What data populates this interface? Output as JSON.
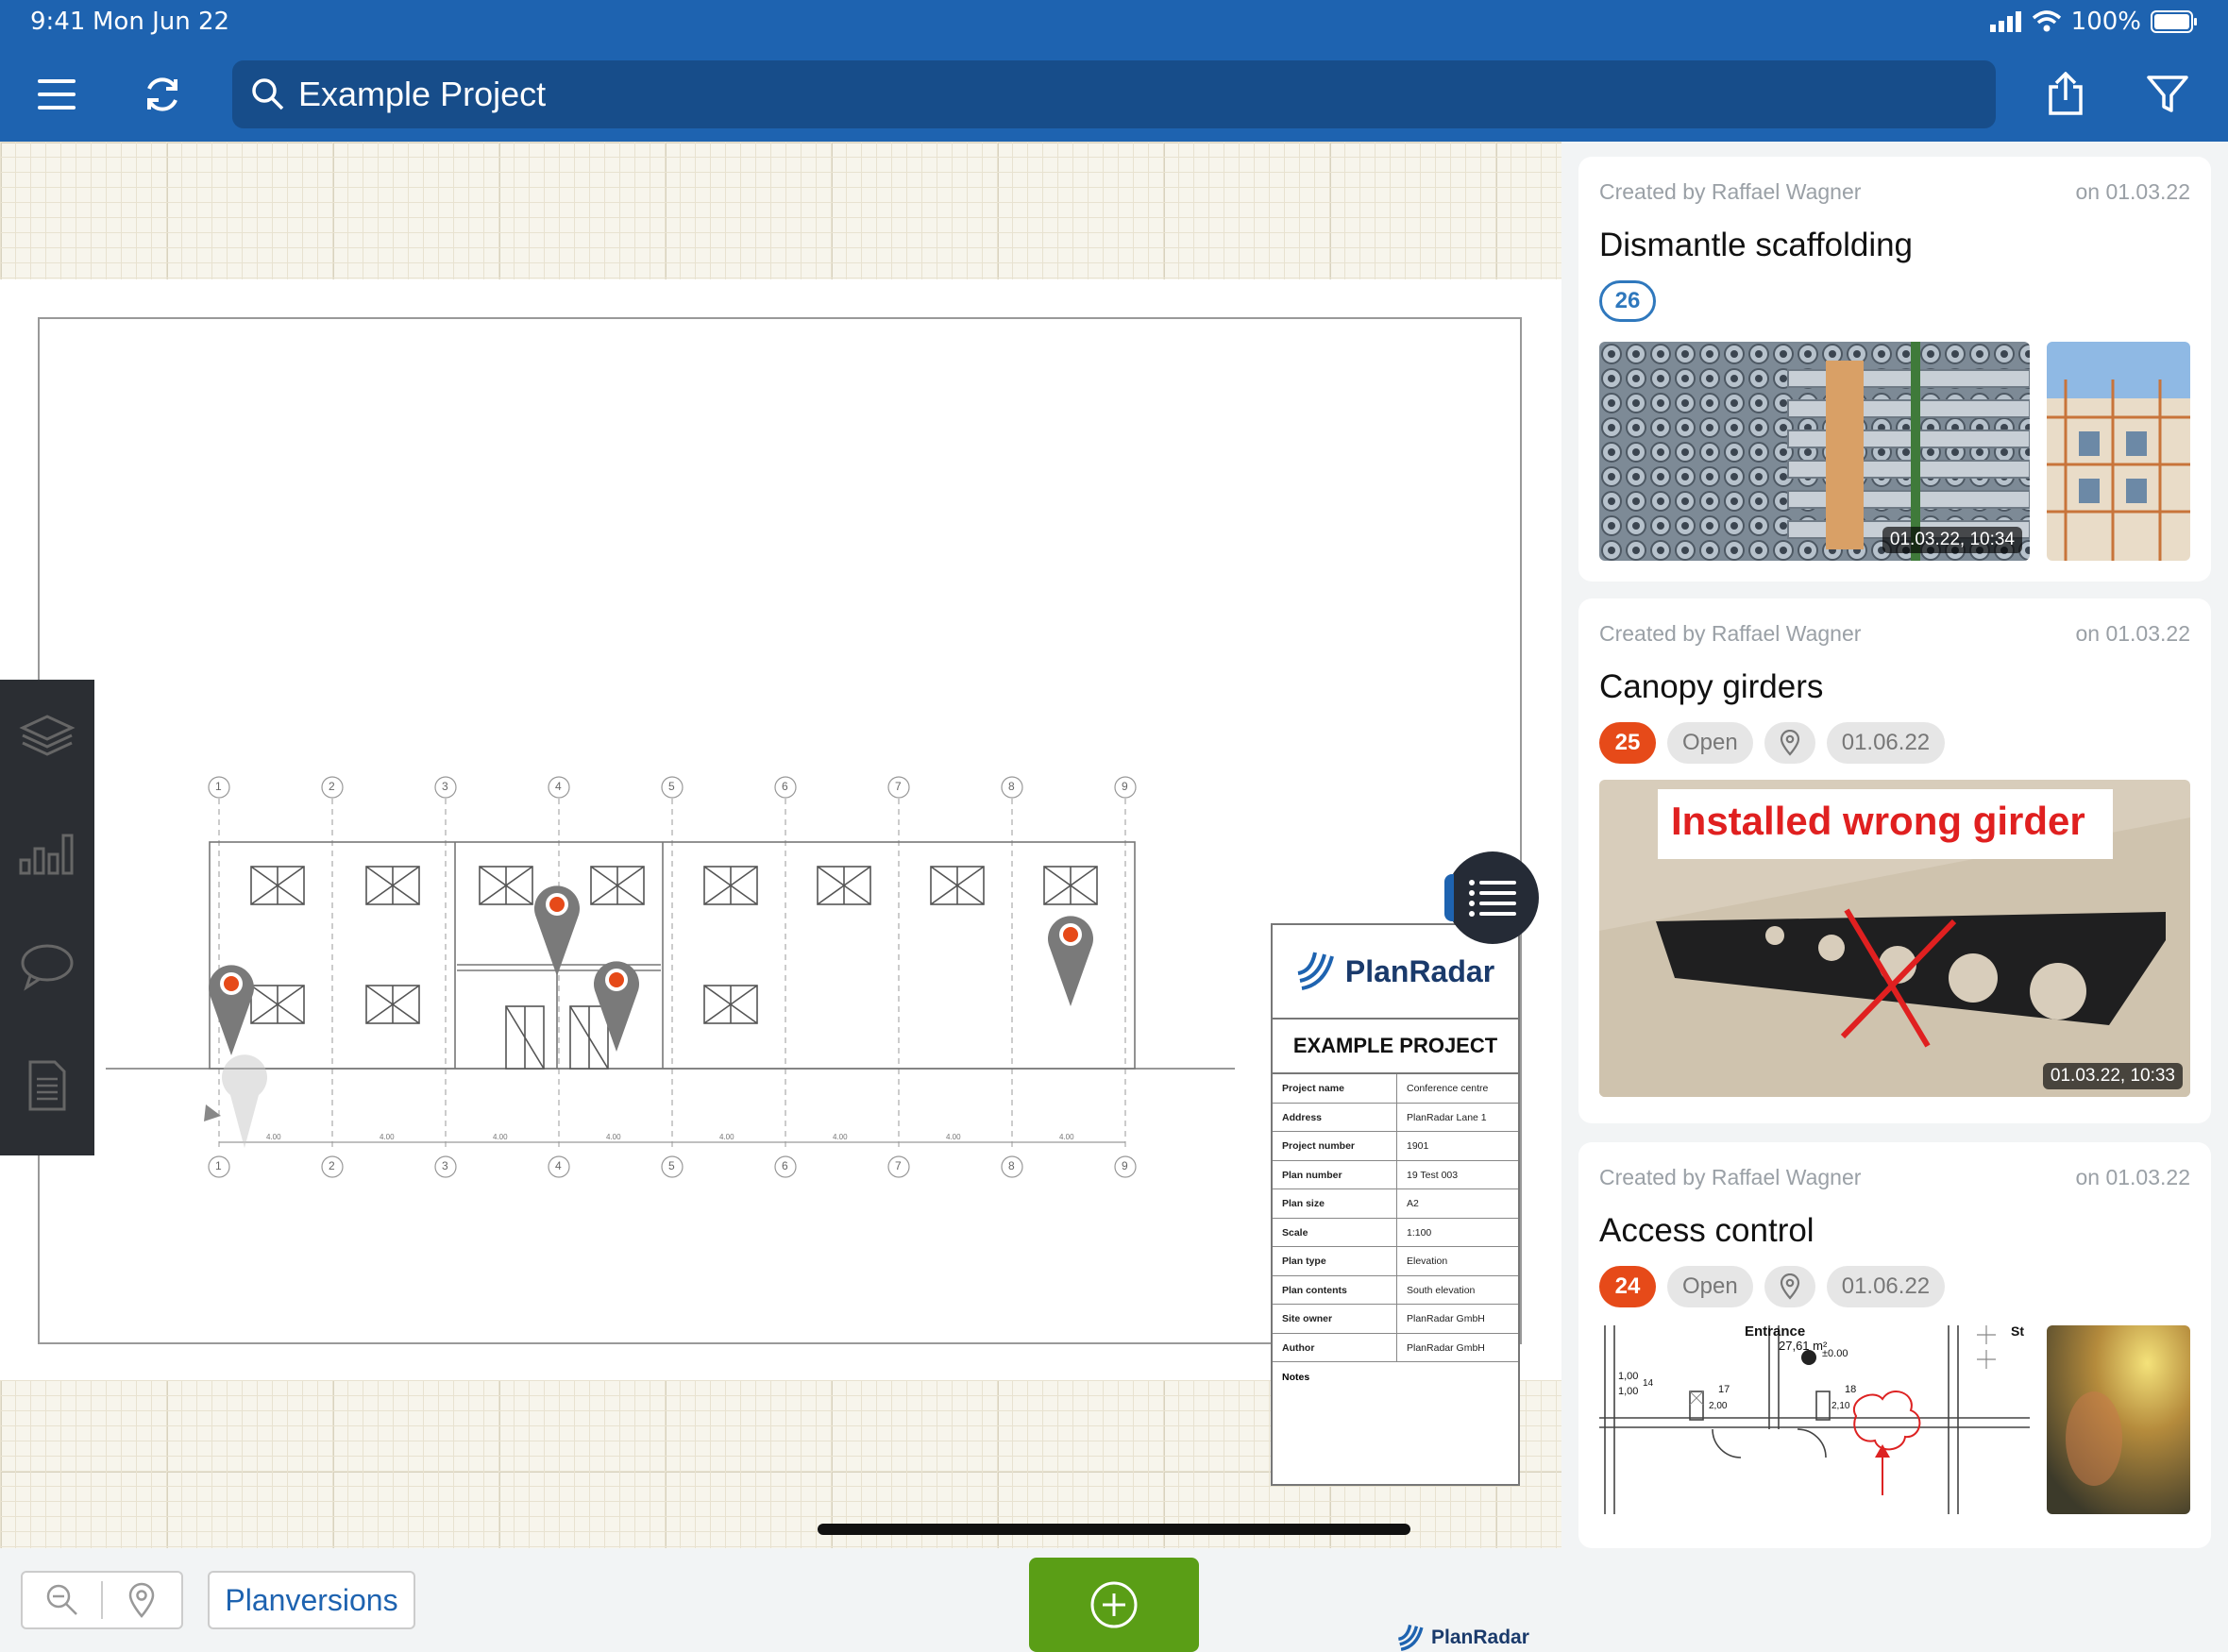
{
  "status_bar": {
    "time": "9:41",
    "date": "Mon Jun 22",
    "battery": "100%"
  },
  "toolbar": {
    "search_value": "Example Project",
    "icons": [
      "menu-icon",
      "refresh-icon",
      "search-icon",
      "share-icon",
      "filter-icon"
    ]
  },
  "plan": {
    "grid_labels": [
      "1",
      "2",
      "3",
      "4",
      "5",
      "6",
      "7",
      "8",
      "9"
    ],
    "dimension": "4.00",
    "title_block": {
      "logo_text": "PlanRadar",
      "project_title": "EXAMPLE PROJECT",
      "rows": [
        {
          "k": "Project name",
          "v": "Conference centre"
        },
        {
          "k": "Address",
          "v": "PlanRadar Lane 1"
        },
        {
          "k": "Project number",
          "v": "1901"
        },
        {
          "k": "Plan number",
          "v": "19 Test 003"
        },
        {
          "k": "Plan size",
          "v": "A2"
        },
        {
          "k": "Scale",
          "v": "1:100"
        },
        {
          "k": "Plan type",
          "v": "Elevation"
        },
        {
          "k": "Plan contents",
          "v": "South elevation"
        },
        {
          "k": "Site owner",
          "v": "PlanRadar GmbH"
        },
        {
          "k": "Author",
          "v": "PlanRadar GmbH"
        }
      ],
      "notes_label": "Notes"
    },
    "watermark": "PlanRadar"
  },
  "bottom": {
    "planversions_label": "Planversions"
  },
  "tickets": [
    {
      "created_by": "Created by Raffael Wagner",
      "date": "on 01.03.22",
      "title": "Dismantle scaffolding",
      "number": "26",
      "status": "",
      "due": "",
      "photo_stamp": "01.03.22, 10:34",
      "photo_caption": ""
    },
    {
      "created_by": "Created by Raffael Wagner",
      "date": "on 01.03.22",
      "title": "Canopy girders",
      "number": "25",
      "status": "Open",
      "due": "01.06.22",
      "photo_stamp": "01.03.22, 10:33",
      "photo_caption": "Installed wrong girder"
    },
    {
      "created_by": "Created by Raffael Wagner",
      "date": "on 01.03.22",
      "title": "Access control",
      "number": "24",
      "status": "Open",
      "due": "01.06.22",
      "photo_stamp": "",
      "photo_caption": "",
      "plan_snippet": {
        "room": "Entrance",
        "area": "27,61 m²",
        "level": "±0.00",
        "dims": [
          "1,00",
          "1,00",
          "17",
          "18",
          "14",
          "2,00",
          "2,10"
        ],
        "extra": "St"
      }
    }
  ],
  "colors": {
    "brand_blue": "#1e63b0",
    "accent_orange": "#e64a19",
    "add_green": "#5a9e16"
  }
}
